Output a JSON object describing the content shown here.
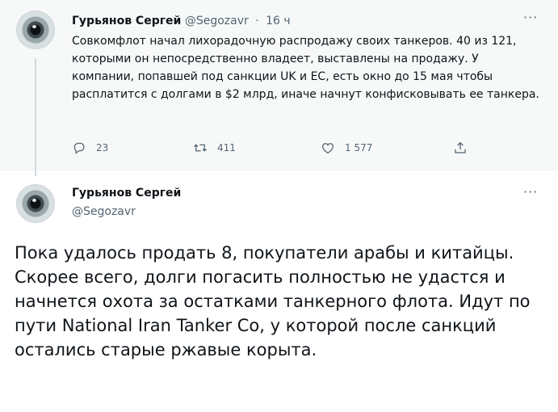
{
  "parent_tweet": {
    "author_name": "Гурьянов Сергей",
    "author_handle": "@Segozavr",
    "separator": "·",
    "time": "16 ч",
    "more": "···",
    "text": "Совкомфлот начал лихорадочную распродажу своих танкеров. 40 из 121, которыми он непосредственно владеет, выставлены на продажу. У компании, попавшей под санкции UK и ЕС, есть окно до 15 мая чтобы расплатится с долгами в $2 млрд, иначе начнут конфисковывать ее танкера.",
    "replies": "23",
    "retweets": "411",
    "likes": "1 577"
  },
  "current_tweet": {
    "author_name": "Гурьянов Сергей",
    "author_handle": "@Segozavr",
    "more": "···",
    "text": "Пока удалось продать 8, покупатели арабы и китайцы.   Скорее всего, долги погасить полностью не удастся и начнется охота за остатками танкерного флота. Идут по пути National Iran Tanker Co, у которой после санкций остались старые ржавые корыта."
  },
  "icons": {
    "reply": "reply-icon",
    "retweet": "retweet-icon",
    "like": "like-icon",
    "share": "share-icon",
    "more": "more-icon"
  },
  "colors": {
    "text": "#0f1419",
    "secondary": "#536471",
    "parent_bg": "#f7f9f9",
    "thread_line": "#cfd9de"
  }
}
